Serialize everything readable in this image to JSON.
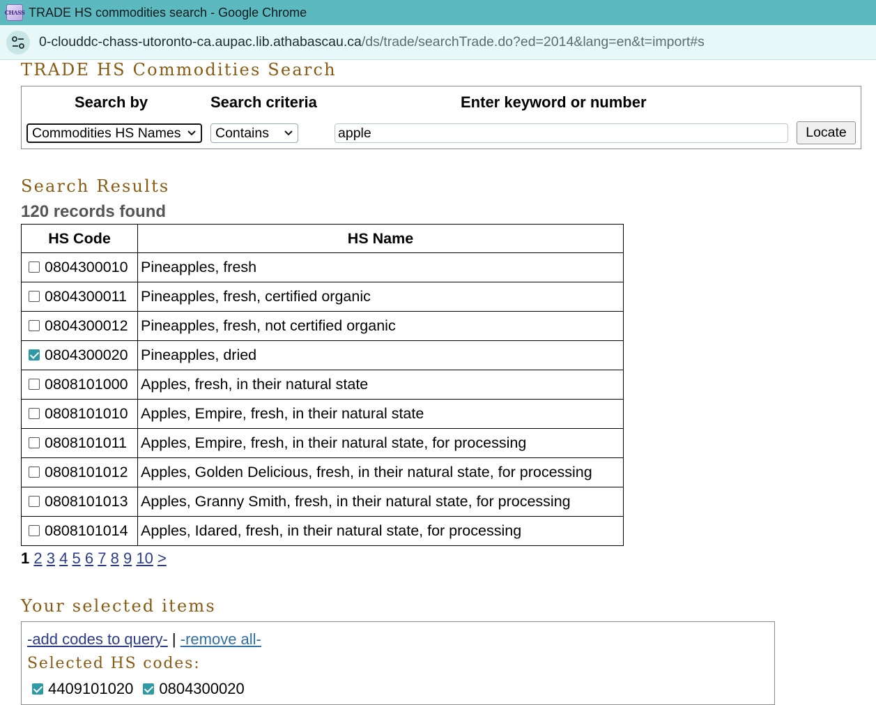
{
  "window": {
    "title": "TRADE HS commodities search - Google Chrome",
    "favicon_text": "CHASS"
  },
  "address_bar": {
    "host": "0-clouddc-chass-utoronto-ca.aupac.lib.athabascau.ca",
    "path": "/ds/trade/searchTrade.do?ed=2014&lang=en&t=import#s"
  },
  "page": {
    "title": "TRADE HS Commodities Search"
  },
  "search": {
    "search_by_label": "Search by",
    "criteria_label": "Search criteria",
    "keyword_label": "Enter keyword or number",
    "search_by_value": "Commodities HS Names",
    "criteria_value": "Contains",
    "keyword_value": "apple",
    "locate_label": "Locate"
  },
  "results": {
    "heading": "Search Results",
    "records_text": "120 records found",
    "columns": [
      "HS Code",
      "HS Name"
    ],
    "rows": [
      {
        "code": "0804300010",
        "name": "Pineapples, fresh",
        "checked": false
      },
      {
        "code": "0804300011",
        "name": "Pineapples, fresh, certified organic",
        "checked": false
      },
      {
        "code": "0804300012",
        "name": "Pineapples, fresh, not certified organic",
        "checked": false
      },
      {
        "code": "0804300020",
        "name": "Pineapples, dried",
        "checked": true
      },
      {
        "code": "0808101000",
        "name": "Apples, fresh, in their natural state",
        "checked": false
      },
      {
        "code": "0808101010",
        "name": "Apples, Empire, fresh, in their natural state",
        "checked": false
      },
      {
        "code": "0808101011",
        "name": "Apples, Empire, fresh, in their natural state, for processing",
        "checked": false
      },
      {
        "code": "0808101012",
        "name": "Apples, Golden Delicious, fresh, in their natural state, for processing",
        "checked": false
      },
      {
        "code": "0808101013",
        "name": "Apples, Granny Smith, fresh, in their natural state, for processing",
        "checked": false
      },
      {
        "code": "0808101014",
        "name": "Apples, Idared, fresh, in their natural state, for processing",
        "checked": false
      }
    ]
  },
  "pagination": {
    "current": "1",
    "pages": [
      "2",
      "3",
      "4",
      "5",
      "6",
      "7",
      "8",
      "9",
      "10"
    ],
    "next": ">"
  },
  "selected": {
    "heading": "Your selected items",
    "add_link": "-add codes to query-",
    "separator": "|",
    "remove_link": "-remove all-",
    "codes_label": "Selected HS codes:",
    "codes": [
      "4409101020",
      "0804300020"
    ]
  },
  "colors": {
    "titlebar": "#5cb9bf",
    "addressbar": "#e8f7f7",
    "heading": "#8a5a12",
    "link": "#2b3a8f",
    "checkbox_checked": "#2f9aa4"
  }
}
